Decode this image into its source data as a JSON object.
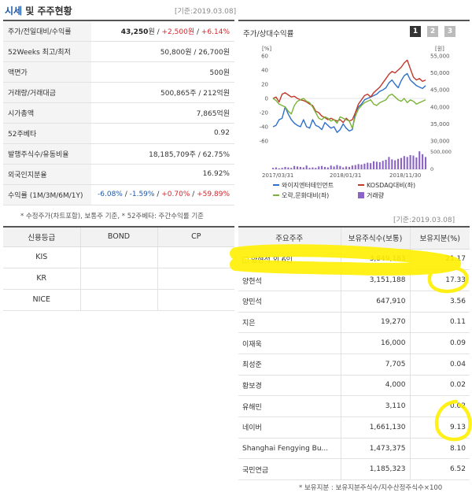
{
  "header": {
    "title_main": "시세",
    "title_rest": " 및 주주현황",
    "base_date": "[기준:2019.03.08]"
  },
  "price_rows": [
    {
      "label": "주가/전일대비/수익률",
      "v1": "43,250",
      "u1": "원",
      "sep1": " / ",
      "v2": "+2,500",
      "u2": "원",
      "sep2": " / ",
      "v3": "+6.14%"
    },
    {
      "label": "52Weeks 최고/최저",
      "value": "50,800원 / 26,700원"
    },
    {
      "label": "액면가",
      "value": "500원"
    },
    {
      "label": "거래량/거래대금",
      "value": "500,865주 / 212억원"
    },
    {
      "label": "시가총액",
      "value": "7,865억원"
    },
    {
      "label": "52주베타",
      "value": "0.92"
    },
    {
      "label": "발행주식수/유동비율",
      "value": "18,185,709주 / 62.75%"
    },
    {
      "label": "외국인지분율",
      "value": "16.92%"
    },
    {
      "label": "수익률 (1M/3M/6M/1Y)",
      "r1": "-6.08%",
      "r2": "-1.59%",
      "r3": "+0.70%",
      "r4": "+59.89%",
      "sep": " / "
    }
  ],
  "price_note": "* 수정주가(차트포함), 보통주 기준, * 52주베타: 주간수익률 기준",
  "chart_panel": {
    "title": "주가/상대수익률",
    "pages": [
      "1",
      "2",
      "3"
    ],
    "active_page": 0
  },
  "chart_data": {
    "type": "line",
    "left_axis_unit": "[%]",
    "right_axis_unit": "[원]",
    "left_ticks": [
      "60",
      "40",
      "20",
      "0",
      "-20",
      "-40",
      "-60"
    ],
    "right_ticks": [
      "55,000",
      "50,000",
      "45,000",
      "40,000",
      "35,000",
      "30,000"
    ],
    "vol_ticks": [
      "500,000",
      "0"
    ],
    "x_labels": [
      "2017/03/31",
      "2018/01/31",
      "2018/11/30"
    ],
    "ylim_left": [
      -60,
      60
    ],
    "ylim_right": [
      30000,
      55000
    ],
    "x": [
      0,
      2,
      4,
      6,
      8,
      10,
      12,
      14,
      16,
      18,
      20,
      22,
      24,
      26,
      28,
      30,
      32,
      34,
      36,
      38,
      40,
      42,
      44,
      46,
      48,
      50,
      52,
      54,
      56,
      58,
      60,
      62,
      64,
      66,
      68,
      70,
      72,
      74,
      76,
      78,
      80,
      82,
      84,
      86,
      88,
      90,
      92,
      94,
      96,
      98,
      100
    ],
    "series": [
      {
        "name": "와이지엔터테인먼트",
        "color": "#2f6fc9",
        "values": [
          -40,
          -38,
          -30,
          -28,
          -12,
          -22,
          -30,
          -35,
          -38,
          -40,
          -30,
          -40,
          -42,
          -30,
          -38,
          -40,
          -44,
          -34,
          -38,
          -42,
          -40,
          -48,
          -44,
          -36,
          -42,
          -46,
          -44,
          -20,
          -12,
          -8,
          -2,
          0,
          2,
          4,
          6,
          10,
          12,
          15,
          22,
          26,
          20,
          15,
          25,
          32,
          35,
          26,
          22,
          18,
          16,
          14,
          18
        ]
      },
      {
        "name": "KOSDAQ대비(좌)",
        "color": "#c0392b",
        "values": [
          0,
          2,
          -5,
          6,
          8,
          5,
          2,
          3,
          0,
          -2,
          -3,
          -5,
          -8,
          -10,
          -18,
          -20,
          -25,
          -27,
          -30,
          -28,
          -30,
          -32,
          -30,
          -34,
          -28,
          -32,
          -30,
          -20,
          -8,
          -2,
          4,
          6,
          2,
          8,
          12,
          16,
          22,
          28,
          34,
          38,
          36,
          40,
          44,
          50,
          54,
          42,
          30,
          26,
          28,
          24,
          26
        ]
      },
      {
        "name": "오락,문화대비(좌)",
        "color": "#7ab338",
        "values": [
          0,
          -3,
          -8,
          -10,
          -12,
          -18,
          -22,
          -10,
          -4,
          -2,
          0,
          -4,
          -6,
          -12,
          -20,
          -28,
          -30,
          -26,
          -28,
          -32,
          -30,
          -35,
          -26,
          -28,
          -30,
          -32,
          -42,
          -25,
          -15,
          -10,
          -6,
          -4,
          -2,
          -8,
          -10,
          -6,
          -4,
          -2,
          4,
          6,
          2,
          -2,
          -4,
          0,
          -6,
          -2,
          -4,
          -8,
          -6,
          -4,
          -2
        ]
      }
    ],
    "volume": {
      "name": "거래량",
      "color": "#8a63c4",
      "values": [
        30,
        40,
        20,
        30,
        50,
        40,
        30,
        70,
        60,
        50,
        40,
        80,
        30,
        40,
        30,
        60,
        70,
        50,
        40,
        80,
        60,
        90,
        70,
        40,
        60,
        50,
        80,
        90,
        110,
        100,
        120,
        140,
        130,
        170,
        160,
        150,
        180,
        200,
        260,
        210,
        190,
        220,
        240,
        280,
        260,
        300,
        290,
        250,
        380,
        320,
        260
      ]
    }
  },
  "credit": {
    "headers": [
      "신용등급",
      "BOND",
      "CP"
    ],
    "rows": [
      [
        "KIS",
        "",
        ""
      ],
      [
        "KR",
        "",
        ""
      ],
      [
        "NICE",
        "",
        ""
      ]
    ]
  },
  "shareholders": {
    "base_date": "[기준:2019.03.08]",
    "headers": [
      "주요주주",
      "보유주식수(보통)",
      "보유지분(%)"
    ],
    "expand_mark": "-",
    "rows": [
      [
        "양현석 외 6인",
        "3,849,183",
        "21.17"
      ],
      [
        "양현석",
        "3,151,188",
        "17.33"
      ],
      [
        "양민석",
        "647,910",
        "3.56"
      ],
      [
        "지은",
        "19,270",
        "0.11"
      ],
      [
        "이재욱",
        "16,000",
        "0.09"
      ],
      [
        "최성준",
        "7,705",
        "0.04"
      ],
      [
        "황보경",
        "4,000",
        "0.02"
      ],
      [
        "유해민",
        "3,110",
        "0.02"
      ],
      [
        "네이버",
        "1,661,130",
        "9.13"
      ],
      [
        "Shanghai Fengying Bu...",
        "1,473,375",
        "8.10"
      ],
      [
        "국민연금",
        "1,185,323",
        "6.52"
      ]
    ],
    "note": "* 보유지분 : 보유지분주식수/지수산정주식수×100"
  },
  "annotations": {
    "highlight_color": "#ffef00"
  }
}
